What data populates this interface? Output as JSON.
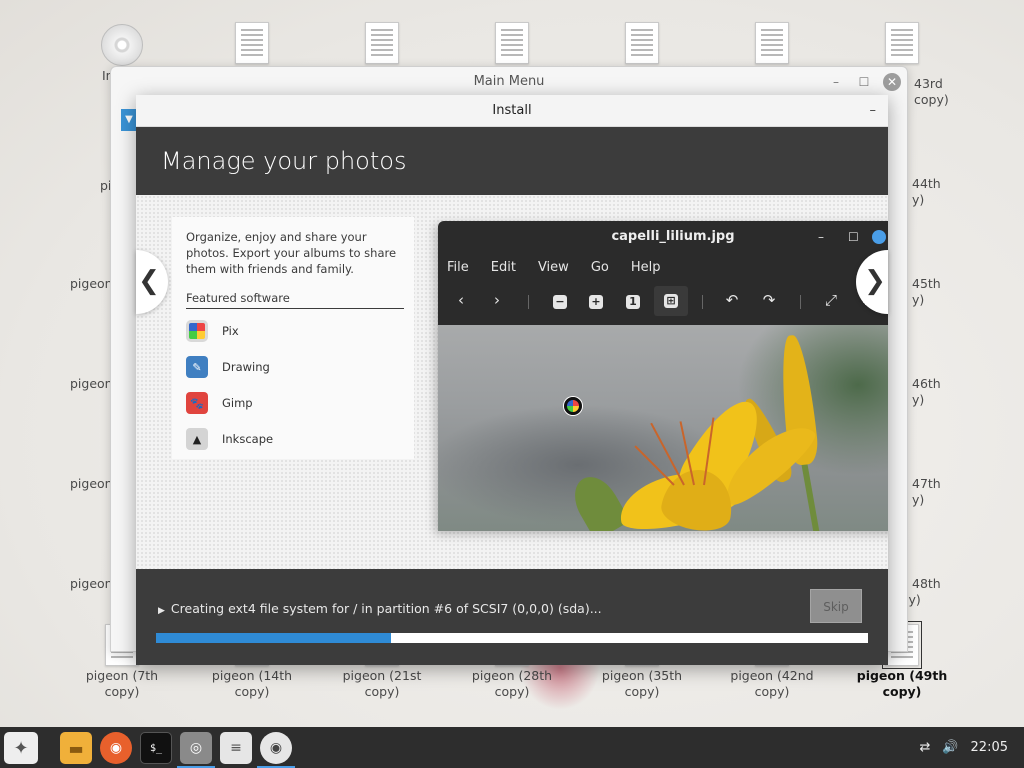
{
  "desktop": {
    "top_row_labels": [
      "In",
      "43rd",
      "copy)"
    ],
    "left_labels": [
      "pigeon",
      "pigeon",
      "pigeon",
      "pigeon",
      "pigeon"
    ],
    "right_labels": [
      [
        "44th",
        "y)"
      ],
      [
        "45th",
        "y)"
      ],
      [
        "46th",
        "y)"
      ],
      [
        "47th",
        "y)"
      ],
      [
        "48th",
        "copy)"
      ]
    ],
    "bottom_labels": [
      [
        "pigeon (7th copy)"
      ],
      [
        "pigeon (14th",
        "copy)"
      ],
      [
        "pigeon (21st",
        "copy)"
      ],
      [
        "pigeon (28th",
        "copy)"
      ],
      [
        "pigeon (35th",
        "copy)"
      ],
      [
        "pigeon (42nd",
        "copy)"
      ],
      [
        "pigeon (49th",
        "copy)"
      ]
    ]
  },
  "main_menu": {
    "title": "Main Menu",
    "minimize": "–",
    "maximize": "☐",
    "close": "✕"
  },
  "install": {
    "title": "Install",
    "minimize": "–",
    "slide_title": "Manage your photos",
    "description": "Organize, enjoy and share your photos. Export your albums to share them with friends and family.",
    "featured_heading": "Featured software",
    "software": [
      {
        "name": "Pix",
        "icon": "pix-icon",
        "color": "#d9d9d9"
      },
      {
        "name": "Drawing",
        "icon": "drawing-icon",
        "color": "#3f7fc1"
      },
      {
        "name": "Gimp",
        "icon": "gimp-icon",
        "color": "#e0443e"
      },
      {
        "name": "Inkscape",
        "icon": "inkscape-icon",
        "color": "#d4d4d4"
      }
    ],
    "prev_arrow": "❮",
    "next_arrow": "❯",
    "progress_text": "Creating ext4 file system for / in partition #6 of SCSI7 (0,0,0) (sda)...",
    "progress": 0.33,
    "skip_label": "Skip"
  },
  "viewer": {
    "filename": "capelli_lilium.jpg",
    "menu": [
      "File",
      "Edit",
      "View",
      "Go",
      "Help"
    ],
    "minimize": "–",
    "maximize": "☐",
    "zoom_1_label": "1"
  },
  "taskbar": {
    "clock": "22:05",
    "apps": [
      "menu",
      "files",
      "firefox",
      "terminal",
      "disks",
      "text-editor",
      "installer"
    ]
  },
  "colors": {
    "accent": "#2f8bd6",
    "header_bg": "#3c3c3c",
    "taskbar_bg": "#2d2d2d"
  }
}
